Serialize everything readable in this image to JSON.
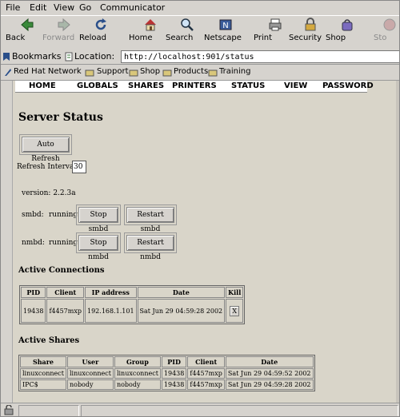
{
  "menu": [
    "File",
    "Edit",
    "View",
    "Go",
    "Communicator"
  ],
  "toolbar": [
    {
      "label": "Back",
      "icon": "back-arrow-icon",
      "enabled": true
    },
    {
      "label": "Forward",
      "icon": "forward-arrow-icon",
      "enabled": false
    },
    {
      "label": "Reload",
      "icon": "reload-icon",
      "enabled": true
    },
    {
      "label": "Home",
      "icon": "home-icon",
      "enabled": true
    },
    {
      "label": "Search",
      "icon": "search-icon",
      "enabled": true
    },
    {
      "label": "Netscape",
      "icon": "netscape-icon",
      "enabled": true
    },
    {
      "label": "Print",
      "icon": "print-icon",
      "enabled": true
    },
    {
      "label": "Security",
      "icon": "lock-icon",
      "enabled": true
    },
    {
      "label": "Shop",
      "icon": "shop-icon",
      "enabled": true
    },
    {
      "label": "Sto",
      "icon": "stop-icon",
      "enabled": false
    }
  ],
  "location": {
    "bookmarks_label": "Bookmarks",
    "location_label": "Location:",
    "url": "http://localhost:901/status"
  },
  "personal_toolbar": [
    "Red Hat Network",
    "Support",
    "Shop",
    "Products",
    "Training"
  ],
  "nav": [
    "HOME",
    "GLOBALS",
    "SHARES",
    "PRINTERS",
    "STATUS",
    "VIEW",
    "PASSWORD"
  ],
  "page": {
    "title": "Server Status",
    "auto_refresh": "Auto Refresh",
    "refresh_label": "Refresh Interval:",
    "refresh_value": "30",
    "version": "version:  2.2.3a",
    "smbd_label": "smbd:",
    "smbd_state": "running",
    "stop_smbd": "Stop smbd",
    "restart_smbd": "Restart smbd",
    "nmbd_label": "nmbd:",
    "nmbd_state": "running",
    "stop_nmbd": "Stop nmbd",
    "restart_nmbd": "Restart nmbd"
  },
  "connections": {
    "heading": "Active Connections",
    "headers": [
      "PID",
      "Client",
      "IP address",
      "Date",
      "Kill"
    ],
    "rows": [
      [
        "19438",
        "f4457mxp",
        "192.168.1.101",
        "Sat Jun 29 04:59:28 2002",
        "X"
      ]
    ]
  },
  "shares": {
    "heading": "Active Shares",
    "headers": [
      "Share",
      "User",
      "Group",
      "PID",
      "Client",
      "Date"
    ],
    "rows": [
      [
        "linuxconnect",
        "linuxconnect",
        "linuxconnect",
        "19438",
        "f4457mxp",
        "Sat Jun 29 04:59:52 2002"
      ],
      [
        "IPC$",
        "nobody",
        "nobody",
        "19438",
        "f4457mxp",
        "Sat Jun 29 04:59:28 2002"
      ]
    ]
  }
}
